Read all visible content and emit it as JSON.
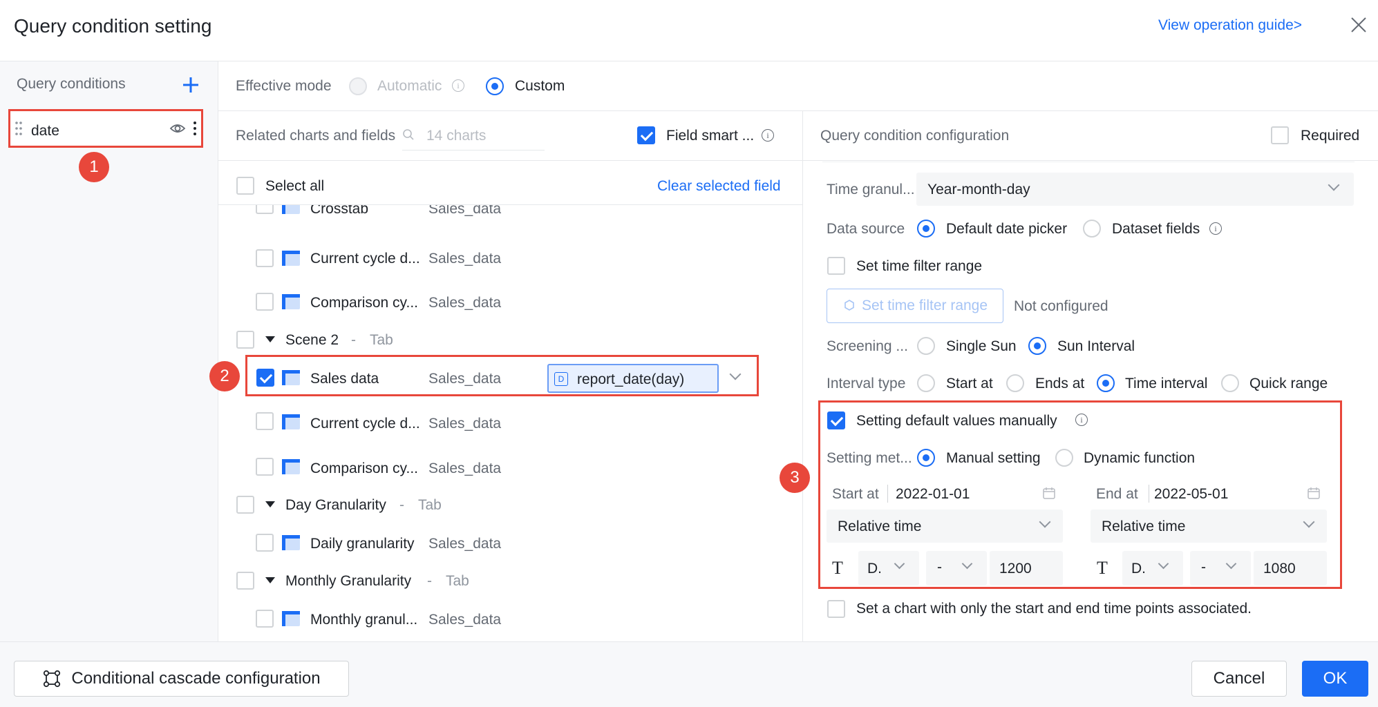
{
  "header": {
    "title": "Query condition setting",
    "guide_link": "View operation guide>"
  },
  "left": {
    "title": "Query conditions",
    "conditions": [
      {
        "name": "date"
      }
    ]
  },
  "mode": {
    "label": "Effective mode",
    "options": [
      "Automatic",
      "Custom"
    ],
    "selected": "Custom"
  },
  "related": {
    "title": "Related charts and fields",
    "search_placeholder": "14 charts",
    "smart_label": "Field smart ...",
    "select_all": "Select all",
    "clear": "Clear selected field",
    "rows": [
      {
        "kind": "chart",
        "name": "Crosstab",
        "dataset": "Sales_data",
        "checked": false
      },
      {
        "kind": "chart",
        "name": "Current cycle d...",
        "dataset": "Sales_data",
        "checked": false
      },
      {
        "kind": "chart",
        "name": "Comparison cy...",
        "dataset": "Sales_data",
        "checked": false
      },
      {
        "kind": "group",
        "name": "Scene 2",
        "tag": "Tab"
      },
      {
        "kind": "chart",
        "name": "Sales data",
        "dataset": "Sales_data",
        "checked": true,
        "field": "report_date(day)"
      },
      {
        "kind": "chart",
        "name": "Current cycle d...",
        "dataset": "Sales_data",
        "checked": false
      },
      {
        "kind": "chart",
        "name": "Comparison cy...",
        "dataset": "Sales_data",
        "checked": false
      },
      {
        "kind": "group",
        "name": "Day Granularity",
        "tag": "Tab"
      },
      {
        "kind": "chart",
        "name": "Daily granularity",
        "dataset": "Sales_data",
        "checked": false
      },
      {
        "kind": "group",
        "name": "Monthly Granularity",
        "tag": "Tab"
      },
      {
        "kind": "chart",
        "name": "Monthly granul...",
        "dataset": "Sales_data",
        "checked": false
      }
    ]
  },
  "config": {
    "title": "Query condition configuration",
    "required": "Required",
    "time_gran_label": "Time granul...",
    "time_gran_value": "Year-month-day",
    "data_source_label": "Data source",
    "data_source_options": [
      "Default date picker",
      "Dataset fields"
    ],
    "set_range_label": "Set time filter range",
    "set_range_button": "Set time filter range",
    "not_configured": "Not configured",
    "screening_label": "Screening ...",
    "screening_options": [
      "Single Sun",
      "Sun Interval"
    ],
    "interval_label": "Interval type",
    "interval_options": [
      "Start at",
      "Ends at",
      "Time interval",
      "Quick range"
    ],
    "default_manual": "Setting default values manually",
    "setting_method_label": "Setting met...",
    "setting_method_options": [
      "Manual setting",
      "Dynamic function"
    ],
    "start_label": "Start at",
    "start_value": "2022-01-01",
    "end_label": "End at",
    "end_value": "2022-05-01",
    "relative_time": "Relative time",
    "unit_short": "D.",
    "dash": "-",
    "start_offset": "1200",
    "end_offset": "1080",
    "only_points": "Set a chart with only the start and end time points associated."
  },
  "footer": {
    "cascade": "Conditional cascade configuration",
    "cancel": "Cancel",
    "ok": "OK"
  },
  "badges": [
    "1",
    "2",
    "3"
  ],
  "colors": {
    "accent": "#1b6df5",
    "highlight": "#e8473b"
  }
}
